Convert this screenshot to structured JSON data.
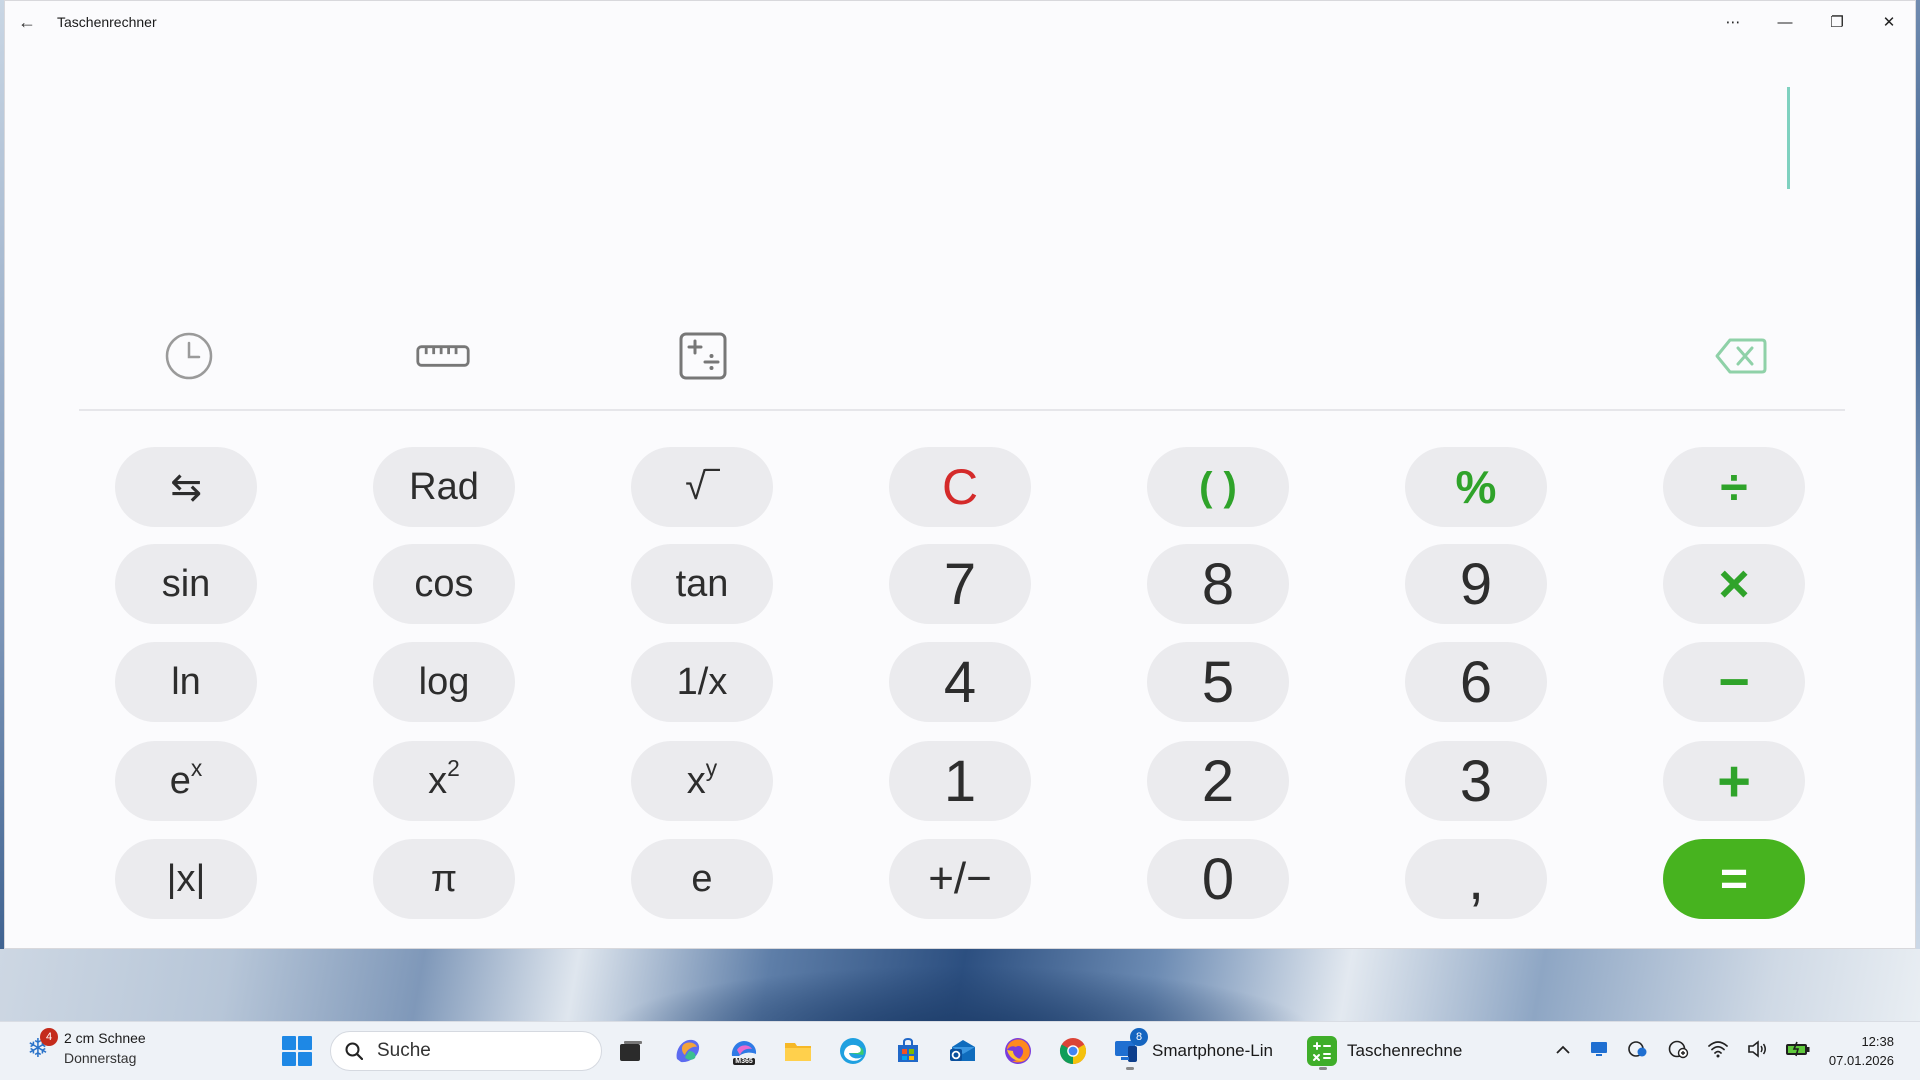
{
  "window": {
    "title": "Taschenrechner",
    "back_glyph": "←",
    "more_glyph": "⋯",
    "minimize_glyph": "—",
    "restore_glyph": "❐",
    "close_glyph": "✕"
  },
  "colors": {
    "accent_green": "#47b31f",
    "clear_red": "#d42a2a",
    "cursor": "#7fd1c0",
    "key_bg": "#ebebee"
  },
  "tools": [
    "history-icon",
    "ruler-icon",
    "calculator-mode-icon",
    "backspace-icon"
  ],
  "keys": {
    "row1": [
      "⇆",
      "Rad",
      "√‾",
      "C",
      "( )",
      "%",
      "÷"
    ],
    "row2": [
      "sin",
      "cos",
      "tan",
      "7",
      "8",
      "9",
      "×"
    ],
    "row3": [
      "ln",
      "log",
      "1/x",
      "4",
      "5",
      "6",
      "−"
    ],
    "row4_base": [
      "e",
      "x",
      "x"
    ],
    "row4_sup": [
      "x",
      "2",
      "y"
    ],
    "row4": [
      "1",
      "2",
      "3",
      "+"
    ],
    "row5": [
      "|x|",
      "π",
      "e",
      "+/−",
      "0",
      ",",
      "="
    ]
  },
  "taskbar": {
    "weather_badge": "4",
    "weather_title": "2 cm Schnee",
    "weather_sub": "Donnerstag",
    "search_placeholder": "Suche",
    "m365_label": "M365",
    "phone_link_label": "Smartphone-Lin",
    "phone_link_badge": "8",
    "calculator_label": "Taschenrechne",
    "time": "12:38",
    "date": "07.01.2026"
  }
}
